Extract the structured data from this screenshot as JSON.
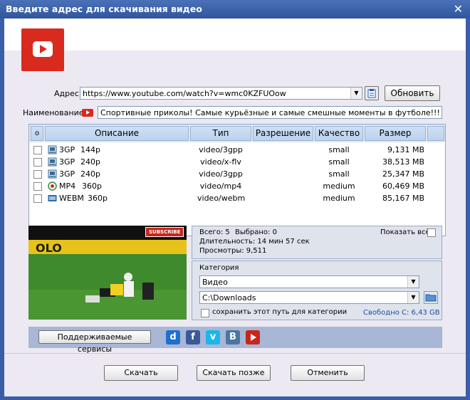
{
  "window": {
    "title": "Введите адрес для скачивания видео",
    "close": "✕"
  },
  "url": {
    "label": "Адрес",
    "value": "https://www.youtube.com/watch?v=wmc0KZFUOow",
    "refresh_label": "Обновить"
  },
  "name": {
    "label": "Наименование",
    "value": "Спортивные приколы! Самые курьёзные и самые смешные моменты в футболе!!!"
  },
  "table": {
    "headers": {
      "select": "о",
      "description": "Описание",
      "type": "Тип",
      "resolution": "Разрешение",
      "quality": "Качество",
      "size": "Размер"
    },
    "rows": [
      {
        "icon": "3gp-file-icon",
        "format": "3GP",
        "res": "144p",
        "type": "video/3gpp",
        "quality": "small",
        "size": "9,131 МВ"
      },
      {
        "icon": "3gp-file-icon",
        "format": "3GP",
        "res": "240p",
        "type": "video/x-flv",
        "quality": "small",
        "size": "38,513 МВ"
      },
      {
        "icon": "3gp-file-icon",
        "format": "3GP",
        "res": "240p",
        "type": "video/3gpp",
        "quality": "small",
        "size": "25,347 МВ"
      },
      {
        "icon": "mp4-file-icon",
        "format": "MP4",
        "res": "360p",
        "type": "video/mp4",
        "quality": "medium",
        "size": "60,469 МВ"
      },
      {
        "icon": "webm-file-icon",
        "format": "WEBM",
        "res": "360p",
        "type": "video/webm",
        "quality": "medium",
        "size": "85,167 МВ"
      }
    ]
  },
  "thumbnail": {
    "subscribe": "SUBSCRIBE",
    "banner_text": "OLO"
  },
  "info": {
    "total": "Всего: 5",
    "selected": "Выбрано: 0",
    "duration": "Длительность: 14 мин 57 сек",
    "views": "Просмотры: 9,511",
    "show_all": "Показать всё"
  },
  "category": {
    "title": "Категория",
    "selected": "Видео",
    "path": "C:\\Downloads",
    "save_path_label": "сохранить этот путь для категории",
    "free_space": "Свободно С: 6,43 GB"
  },
  "services": {
    "button_label": "Поддерживаемые сервисы"
  },
  "footer": {
    "download": "Скачать",
    "download_later": "Скачать позже",
    "cancel": "Отменить"
  },
  "colors": {
    "frame": "#3a5fa6",
    "youtube_red": "#d92a1e",
    "header_blue": "#bcd2ee",
    "link_blue": "#1f4fa0"
  }
}
